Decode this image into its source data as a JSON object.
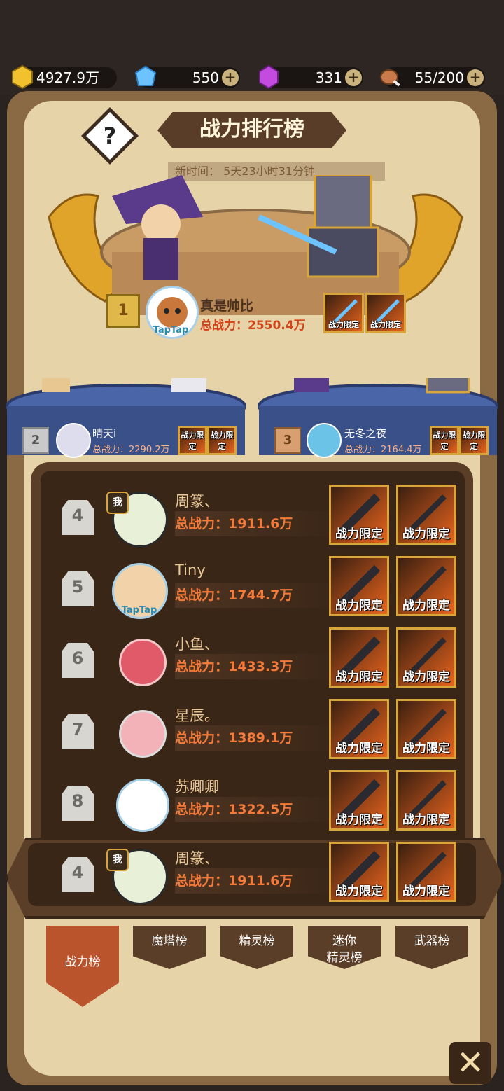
{
  "resources": {
    "gold": "4927.9万",
    "diamond": "550",
    "crystal": "331",
    "stamina": "55/200",
    "plus": "+"
  },
  "header": {
    "title": "战力排行榜",
    "help": "?",
    "refresh_timer": "新时间：  5天23小时31分钟"
  },
  "top3": [
    {
      "rank": "1",
      "name": "真是帅比",
      "power": "总战力：2550.4万"
    },
    {
      "rank": "2",
      "name": "晴天i",
      "power": "总战力：2290.2万"
    },
    {
      "rank": "3",
      "name": "无冬之夜",
      "power": "总战力：2164.4万"
    }
  ],
  "weapon_label": "战力限定",
  "me_badge": "我",
  "avatar_label": "TapTap",
  "rows": [
    {
      "rank": "4",
      "name": "周篆、",
      "power": "总战力：1911.6万"
    },
    {
      "rank": "5",
      "name": "Tiny",
      "power": "总战力：1744.7万"
    },
    {
      "rank": "6",
      "name": "小鱼、",
      "power": "总战力：1433.3万"
    },
    {
      "rank": "7",
      "name": "星辰。",
      "power": "总战力：1389.1万"
    },
    {
      "rank": "8",
      "name": "苏卿卿",
      "power": "总战力：1322.5万"
    }
  ],
  "my_row": {
    "rank": "4",
    "name": "周篆、",
    "power": "总战力：1911.6万"
  },
  "tabs": [
    {
      "label": "战力榜"
    },
    {
      "label": "魔塔榜"
    },
    {
      "label": "精灵榜"
    },
    {
      "label": "迷你\n精灵榜"
    },
    {
      "label": "武器榜"
    }
  ],
  "close": "✕",
  "colors": {
    "accent": "#b9542c",
    "power_text": "#f47a3a",
    "frame": "#5b3e28"
  }
}
